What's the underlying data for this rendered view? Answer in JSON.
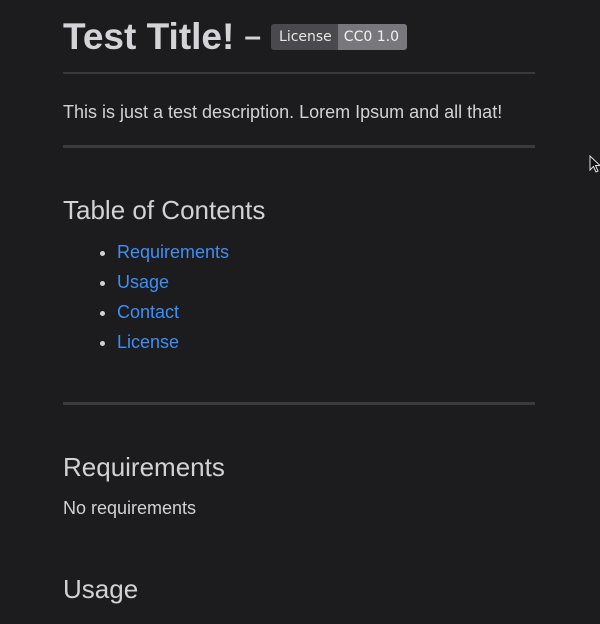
{
  "title": "Test Title!",
  "separator": "–",
  "badge": {
    "label": "License",
    "value": "CC0 1.0"
  },
  "description": "This is just a test description. Lorem Ipsum and all that!",
  "toc": {
    "heading": "Table of Contents",
    "items": [
      "Requirements",
      "Usage",
      "Contact",
      "License"
    ]
  },
  "requirements": {
    "heading": "Requirements",
    "text": "No requirements"
  },
  "usage": {
    "heading": "Usage"
  }
}
